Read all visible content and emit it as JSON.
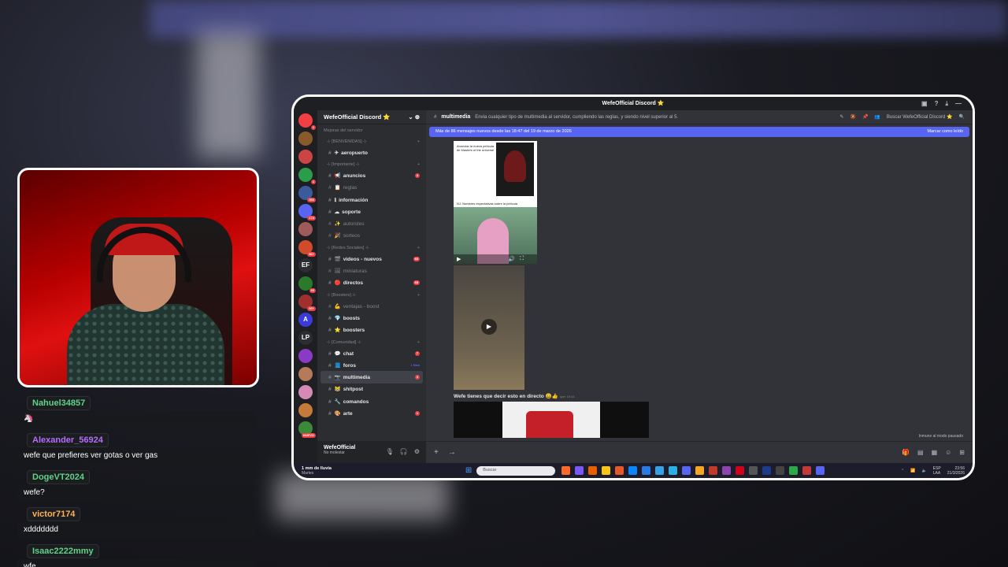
{
  "window": {
    "title": "WefeOfficial Discord ⭐"
  },
  "server": {
    "name": "WefeOfficial Discord ⭐",
    "top_item": "Mejoras del servidor"
  },
  "servers": [
    {
      "color": "#f23f43",
      "badge": "1"
    },
    {
      "color": "#8b5a2b",
      "badge": ""
    },
    {
      "color": "#c44",
      "badge": ""
    },
    {
      "color": "#2a9d4b",
      "badge": "1"
    },
    {
      "color": "#3a5a9c",
      "badge": "366"
    },
    {
      "color": "#5865f2",
      "badge": "174"
    },
    {
      "color": "#a05a5a",
      "badge": ""
    },
    {
      "color": "#d24a2a",
      "badge": "96+"
    },
    {
      "color": "#2b2d31",
      "label": "EF"
    },
    {
      "color": "#2a7a2a",
      "badge": "33"
    },
    {
      "color": "#a03030",
      "badge": "96+"
    },
    {
      "color": "#3b3bdb",
      "label": "A"
    },
    {
      "color": "#2b2d31",
      "label": "LP"
    },
    {
      "color": "#8a3ac4",
      "badge": ""
    },
    {
      "color": "#b47a5a",
      "badge": ""
    },
    {
      "color": "#d48ab4",
      "badge": ""
    },
    {
      "color": "#c47a3a",
      "badge": ""
    },
    {
      "color": "#3a8a3a",
      "badge": "NUEVO"
    }
  ],
  "channels": [
    {
      "type": "cat",
      "label": "⊹ [BENVENIDAS] ⊹"
    },
    {
      "type": "ch",
      "label": "aeropuerto",
      "icon": "✈",
      "style": "bold"
    },
    {
      "type": "cat",
      "label": "⊹ [Importante] ⊹"
    },
    {
      "type": "ch",
      "label": "anuncios",
      "icon": "📢",
      "style": "bold",
      "badge": "4"
    },
    {
      "type": "ch",
      "label": "reglas",
      "icon": "📋",
      "style": "muted"
    },
    {
      "type": "ch",
      "label": "información",
      "icon": "ℹ",
      "style": "bold"
    },
    {
      "type": "ch",
      "label": "soporte",
      "icon": "☁",
      "style": "bold"
    },
    {
      "type": "ch",
      "label": "autoroles",
      "icon": "✨",
      "style": "muted"
    },
    {
      "type": "ch",
      "label": "sorteos",
      "icon": "🎉",
      "style": "muted"
    },
    {
      "type": "cat",
      "label": "⊹ [Redes Sociales] ⊹"
    },
    {
      "type": "ch",
      "label": "videos - nuevos",
      "icon": "🎬",
      "style": "bold",
      "badge": "83"
    },
    {
      "type": "ch",
      "label": "miniaturas",
      "icon": "🖼",
      "style": "muted"
    },
    {
      "type": "ch",
      "label": "directos",
      "icon": "🔴",
      "style": "bold",
      "badge": "68"
    },
    {
      "type": "cat",
      "label": "⊹ [Boosters] ⊹"
    },
    {
      "type": "ch",
      "label": "ventajas - boost",
      "icon": "💪",
      "style": "muted"
    },
    {
      "type": "ch",
      "label": "boosts",
      "icon": "💎",
      "style": "bold"
    },
    {
      "type": "ch",
      "label": "boosters",
      "icon": "⭐",
      "style": "bold"
    },
    {
      "type": "cat",
      "label": "⊹ [Comunidad] ⊹"
    },
    {
      "type": "ch",
      "label": "chat",
      "icon": "💬",
      "style": "bold",
      "badge": "7"
    },
    {
      "type": "ch",
      "label": "foros",
      "icon": "📘",
      "style": "bold",
      "new": "1 New"
    },
    {
      "type": "ch",
      "label": "multimedia",
      "icon": "📷",
      "style": "active",
      "badge": "3"
    },
    {
      "type": "ch",
      "label": "shitpost",
      "icon": "😹",
      "style": "bold"
    },
    {
      "type": "ch",
      "label": "comandos",
      "icon": "🔧",
      "style": "bold"
    },
    {
      "type": "ch",
      "label": "arte",
      "icon": "🎨",
      "style": "bold",
      "badge": "1"
    }
  ],
  "user": {
    "name": "WefeOfficial",
    "status": "No molestar"
  },
  "main": {
    "channel_name": "multimedia",
    "topic": "Envia cualquier tipo de multimedia al servidor, cumpliendo las reglas, y siendo nivel superior al 5.",
    "search_placeholder": "Buscar WefeOfficial Discord ⭐",
    "new_messages": "Más de 86 mensajes nuevos desde las 18:47 del 19 de marzo de 2026",
    "mark_read": "Marcar como leído",
    "poster_text": "Anunciar la nueva película de Masters of the universe",
    "poster_caption": "NJ: Nombres expectativas sobre la película",
    "message_text": "Wefe tienes que decir esto en directo 😀👍",
    "message_time": "ayer 19:43",
    "idle_notice": "Inmune al modo pausado"
  },
  "taskbar": {
    "weather_temp": "1 mm de lluvia",
    "weather_day": "Martes",
    "search": "Buscar",
    "lang": "ESP\nLAA",
    "time": "23:56",
    "date": "21/3/2026"
  },
  "chat": [
    {
      "user": "Nahuel34857",
      "color": "#5fd38a",
      "text": "🦄"
    },
    {
      "user": "Alexander_56924",
      "color": "#b66cff",
      "text": "wefe que prefieres ver gotas o ver gas"
    },
    {
      "user": "DogeVT2024",
      "color": "#5fd38a",
      "text": "wefe?"
    },
    {
      "user": "victor7174",
      "color": "#ffb15c",
      "text": "xddddddd"
    },
    {
      "user": "Isaac2222mmy",
      "color": "#5fd38a",
      "text": "wfe"
    }
  ]
}
